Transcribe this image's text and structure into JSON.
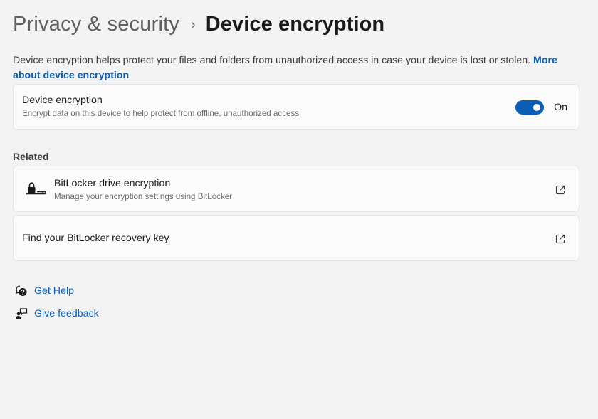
{
  "breadcrumb": {
    "parent": "Privacy & security",
    "separator": "›",
    "current": "Device encryption"
  },
  "description": {
    "text": "Device encryption helps protect your files and folders from unauthorized access in case your device is lost or stolen. ",
    "link": "More about device encryption"
  },
  "encryption_card": {
    "title": "Device encryption",
    "subtitle": "Encrypt data on this device to help protect from offline, unauthorized access",
    "toggle_state": "On",
    "toggle_color": "#0a5fb4"
  },
  "related": {
    "label": "Related",
    "items": [
      {
        "title": "BitLocker drive encryption",
        "subtitle": "Manage your encryption settings using BitLocker",
        "icon": "drive-lock-icon",
        "action_icon": "open-external-icon"
      },
      {
        "title": "Find your BitLocker recovery key",
        "action_icon": "open-external-icon"
      }
    ]
  },
  "help_links": [
    {
      "label": "Get Help",
      "icon": "help-chat-icon"
    },
    {
      "label": "Give feedback",
      "icon": "feedback-icon"
    }
  ],
  "accent_color": "#0a5fb4"
}
